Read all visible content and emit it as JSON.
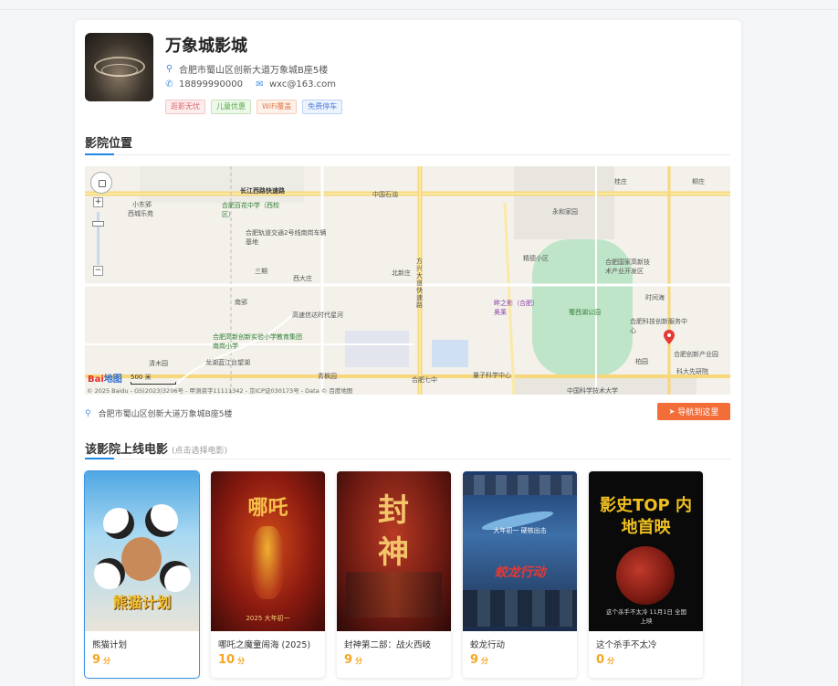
{
  "cinema": {
    "name": "万象城影城",
    "address": "合肥市蜀山区创新大道万象城B座5楼",
    "phone": "18899990000",
    "email": "wxc@163.com",
    "tags": [
      "逛影无忧",
      "儿童优惠",
      "WiFi覆盖",
      "免费停车"
    ]
  },
  "location_section": {
    "title": "影院位置",
    "address": "合肥市蜀山区创新大道万象城B座5楼",
    "navigate_label": "导航到这里"
  },
  "map": {
    "labels": [
      "长江西路快速路",
      "中国石油",
      "合肥百花中学（西校区）",
      "合肥轨道交通2号线南岗车辆基地",
      "三期",
      "西大庄",
      "南郢",
      "高速信达时代星河",
      "合肥高新创新实验小学教育集团南岗小学",
      "龙湖蓝江台望湖",
      "青枫园",
      "合肥七中",
      "量子科学中心",
      "中国科学技术大学",
      "方兴大道快速路",
      "北新庄",
      "畔之影（合肥）奥莱",
      "蜀西湖公园",
      "永和家园",
      "精德小区",
      "合肥科技创新服务中心",
      "时间海",
      "合肥创新产业园",
      "科大先研院",
      "柏园",
      "桂庄",
      "合肥国家高新技术产业开发区",
      "柳庄",
      "小东郢",
      "西城乐苑",
      "清木园"
    ],
    "scale": "500 米",
    "copyright": "© 2025 Baidu - GS(2023)3206号 - 甲测资字11111342 - 京ICP证030173号 - Data © 百度地图",
    "baidu_logo": [
      "Bai",
      "地图"
    ]
  },
  "movies_section": {
    "title": "该影院上线电影",
    "subtitle": "(点击选择电影)",
    "score_unit": "分",
    "movies": [
      {
        "title": "熊猫计划",
        "score": "9",
        "poster_text": "熊猫计划"
      },
      {
        "title": "哪吒之魔童闹海 (2025)",
        "score": "10",
        "poster_text": "哪吒",
        "poster_sub": "2025 大年初一"
      },
      {
        "title": "封神第二部：战火西岐",
        "score": "9",
        "poster_text": "封神"
      },
      {
        "title": "蛟龙行动",
        "score": "9",
        "poster_text": "蛟龙行动",
        "poster_sub": "大年初一 硬核出击"
      },
      {
        "title": "这个杀手不太冷",
        "score": "0",
        "poster_text": "影史TOP 内地首映",
        "poster_sub": "这个杀手不太冷 11月1日 全国上映"
      }
    ]
  },
  "colors": {
    "accent": "#1e88e5",
    "button": "#f36d39",
    "score": "#f5a623"
  },
  "icons": {
    "address": "map-pin-icon",
    "phone": "phone-icon",
    "email": "mail-icon",
    "navigate": "navigate-icon"
  }
}
